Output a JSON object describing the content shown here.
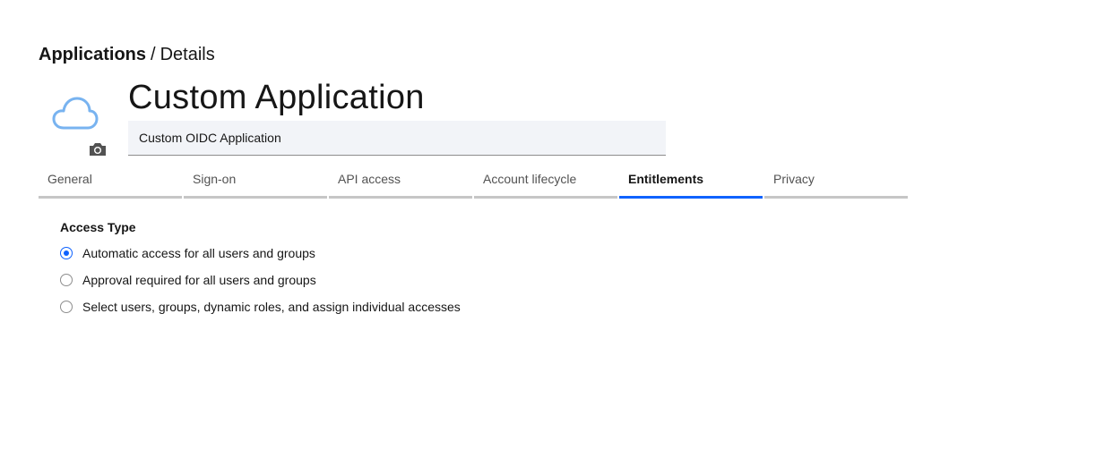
{
  "breadcrumb": {
    "parent": "Applications",
    "separator": "/",
    "current": "Details"
  },
  "app": {
    "icon": "cloud-icon",
    "change_icon": "camera-icon",
    "title": "Custom Application",
    "description": "Custom OIDC Application"
  },
  "tabs": [
    {
      "label": "General",
      "active": false
    },
    {
      "label": "Sign-on",
      "active": false
    },
    {
      "label": "API access",
      "active": false
    },
    {
      "label": "Account lifecycle",
      "active": false
    },
    {
      "label": "Entitlements",
      "active": true
    },
    {
      "label": "Privacy",
      "active": false
    }
  ],
  "access_type": {
    "heading": "Access Type",
    "options": [
      {
        "label": "Automatic access for all users and groups",
        "selected": true
      },
      {
        "label": "Approval required for all users and groups",
        "selected": false
      },
      {
        "label": "Select users, groups, dynamic roles, and assign individual accesses",
        "selected": false
      }
    ]
  },
  "colors": {
    "accent": "#0f62fe",
    "cloud": "#78b3f0",
    "tab_border": "#c6c6c6",
    "input_bg": "#f2f4f8"
  }
}
